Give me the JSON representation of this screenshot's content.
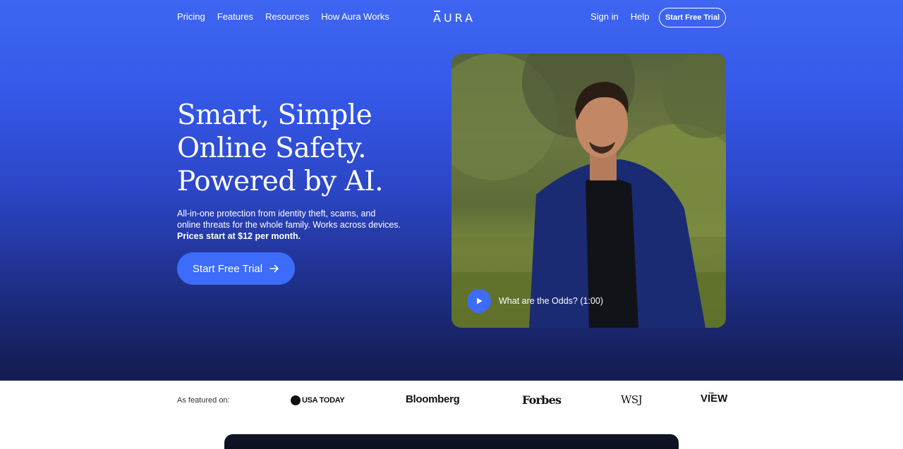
{
  "nav": {
    "left_links": [
      "Pricing",
      "Features",
      "Resources",
      "How Aura Works"
    ],
    "logo": "AURA",
    "sign_in": "Sign in",
    "help": "Help",
    "cta": "Start Free Trial"
  },
  "hero": {
    "headline_lines": [
      "Smart, Simple",
      "Online Safety.",
      "Powered by AI."
    ],
    "subtext_lines": [
      "All-in-one protection from identity theft, scams, and",
      "online threats for the whole family. Works across devices."
    ],
    "subtext_bold": "Prices start at $12 per month.",
    "cta": "Start Free Trial",
    "cta_icon": "arrow-right-icon"
  },
  "video": {
    "label": "What are the Odds? (1:00)",
    "play_icon": "play-icon"
  },
  "featured": {
    "label": "As featured on:",
    "logos": [
      "USA TODAY",
      "Bloomberg",
      "Forbes",
      "WSJ",
      "THE VIEW"
    ],
    "usa_today_wordmark": "USA TODAY",
    "view_small": "THE",
    "view_main": "VIEW"
  },
  "colors": {
    "accent": "#3d6cfa",
    "hero_top": "#3e66f2",
    "hero_bottom": "#131c4d"
  }
}
